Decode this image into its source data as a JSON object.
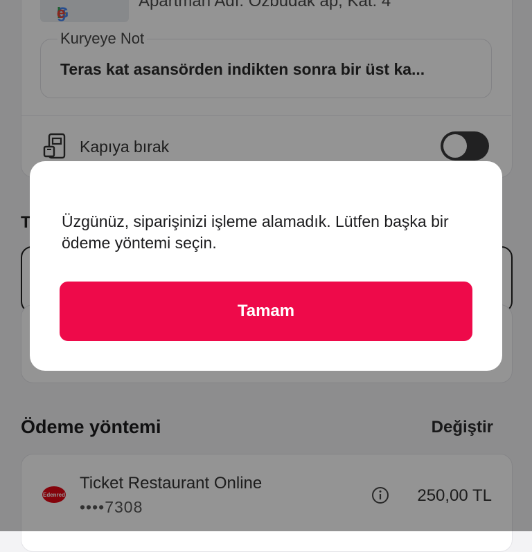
{
  "address": {
    "map_logo": "Google",
    "details": "Apartman Adı: Özbudak ap, Kat: 4",
    "note_label": "Kuryeye Not",
    "note_text": "Teras kat asansörden indikten sonra bir üst ka...",
    "leave_at_door_label": "Kapıya bırak",
    "leave_at_door_enabled": false
  },
  "partial_section_title": "T",
  "payment": {
    "section_title": "Ödeme yöntemi",
    "change_label": "Değiştir",
    "method_name": "Ticket Restaurant Online",
    "card_mask": "••••7308",
    "amount": "250,00 TL",
    "brand_logo": "edenred"
  },
  "dialog": {
    "message": "Üzgünüz, siparişinizi işleme alamadık. Lütfen başka bir ödeme yöntemi seçin.",
    "ok_label": "Tamam"
  },
  "colors": {
    "accent": "#ee0a4a",
    "overlay": "rgba(0,0,0,0.42)"
  }
}
